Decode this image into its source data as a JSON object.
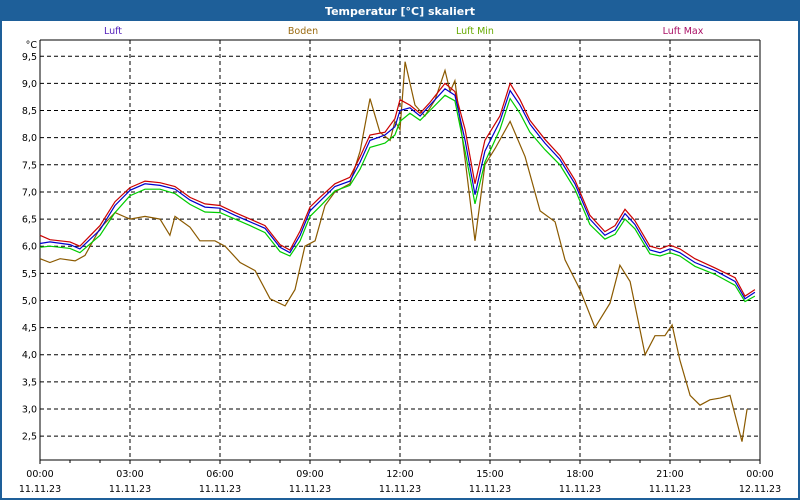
{
  "chart_data": {
    "type": "line",
    "title": "Temperatur [°C] skaliert",
    "ylabel": "°C",
    "xlabel": "",
    "ylim": [
      2.06,
      9.8
    ],
    "xlim_hours": [
      0,
      24
    ],
    "grid": true,
    "legend_placement": "top",
    "yticks": [
      2.5,
      3.0,
      3.5,
      4.0,
      4.5,
      5.0,
      5.5,
      6.0,
      6.5,
      7.0,
      7.5,
      8.0,
      8.5,
      9.0,
      9.5
    ],
    "ytick_labels": [
      "2,5",
      "3,0",
      "3,5",
      "4,0",
      "4,5",
      "5,0",
      "5,5",
      "6,0",
      "6,5",
      "7,0",
      "7,5",
      "8,0",
      "8,5",
      "9,0",
      "9,5"
    ],
    "xticks": [
      {
        "hour": 0,
        "time": "00:00",
        "date": "11.11.23"
      },
      {
        "hour": 3,
        "time": "03:00",
        "date": "11.11.23"
      },
      {
        "hour": 6,
        "time": "06:00",
        "date": "11.11.23"
      },
      {
        "hour": 9,
        "time": "09:00",
        "date": "11.11.23"
      },
      {
        "hour": 12,
        "time": "12:00",
        "date": "11.11.23"
      },
      {
        "hour": 15,
        "time": "15:00",
        "date": "11.11.23"
      },
      {
        "hour": 18,
        "time": "18:00",
        "date": "11.11.23"
      },
      {
        "hour": 21,
        "time": "21:00",
        "date": "11.11.23"
      },
      {
        "hour": 24,
        "time": "00:00",
        "date": "12.11.23"
      }
    ],
    "series": [
      {
        "name": "Luft",
        "color": "#0000cc",
        "label_color": "#5522bb",
        "x": [
          0,
          0.33,
          1,
          1.33,
          2,
          2.5,
          3,
          3.5,
          4,
          4.5,
          5,
          5.5,
          6,
          6.5,
          7,
          7.5,
          8,
          8.33,
          8.67,
          9,
          9.33,
          9.83,
          10.33,
          10.67,
          11,
          11.5,
          11.83,
          12,
          12.33,
          12.67,
          13,
          13.5,
          13.83,
          14.17,
          14.5,
          14.83,
          15.33,
          15.67,
          16,
          16.33,
          16.83,
          17.33,
          17.83,
          18.33,
          18.83,
          19.17,
          19.5,
          19.83,
          20.33,
          20.67,
          21,
          21.33,
          21.83,
          22.5,
          23.17,
          23.5,
          23.83
        ],
        "y": [
          6.05,
          6.08,
          6.03,
          5.95,
          6.3,
          6.75,
          7.03,
          7.15,
          7.12,
          7.05,
          6.85,
          6.72,
          6.7,
          6.57,
          6.45,
          6.33,
          5.98,
          5.88,
          6.2,
          6.65,
          6.83,
          7.1,
          7.2,
          7.55,
          7.95,
          8.05,
          8.2,
          8.5,
          8.55,
          8.4,
          8.6,
          8.9,
          8.78,
          7.95,
          6.95,
          7.75,
          8.3,
          8.87,
          8.6,
          8.25,
          7.9,
          7.6,
          7.15,
          6.5,
          6.2,
          6.3,
          6.6,
          6.4,
          5.93,
          5.88,
          5.95,
          5.88,
          5.7,
          5.55,
          5.35,
          5.03,
          5.15
        ]
      },
      {
        "name": "Boden",
        "color": "#8b5a00",
        "label_color": "#9a6a10",
        "x": [
          0,
          0.33,
          0.67,
          1.17,
          1.5,
          2,
          2.5,
          3,
          3.5,
          4,
          4.33,
          4.5,
          5,
          5.33,
          5.83,
          6.17,
          6.67,
          7.17,
          7.67,
          8.17,
          8.5,
          8.83,
          9.17,
          9.5,
          9.83,
          10.33,
          10.67,
          11,
          11.33,
          11.67,
          11.83,
          12,
          12.17,
          12.5,
          12.83,
          13.17,
          13.5,
          13.67,
          13.83,
          14.17,
          14.5,
          14.83,
          15.17,
          15.67,
          16.17,
          16.67,
          17.17,
          17.5,
          18,
          18.5,
          19,
          19.33,
          19.67,
          20.17,
          20.5,
          20.83,
          21.07,
          21.33,
          21.67,
          22,
          22.33,
          22.67,
          23,
          23.4,
          23.57
        ],
        "y": [
          5.77,
          5.7,
          5.77,
          5.73,
          5.83,
          6.33,
          6.62,
          6.5,
          6.55,
          6.5,
          6.2,
          6.55,
          6.35,
          6.1,
          6.1,
          6.0,
          5.7,
          5.55,
          5.03,
          4.9,
          5.2,
          6.0,
          6.1,
          6.75,
          7.0,
          7.15,
          7.75,
          8.72,
          8.1,
          7.95,
          8.3,
          8.15,
          9.4,
          8.6,
          8.4,
          8.7,
          9.24,
          8.85,
          9.05,
          7.6,
          6.1,
          7.5,
          7.8,
          8.3,
          7.65,
          6.65,
          6.45,
          5.75,
          5.2,
          4.5,
          4.95,
          5.65,
          5.35,
          4.0,
          4.35,
          4.35,
          4.55,
          3.9,
          3.25,
          3.07,
          3.17,
          3.2,
          3.25,
          2.4,
          3.0
        ]
      },
      {
        "name": "Luft Min",
        "color": "#00cc00",
        "label_color": "#66aa00",
        "x": [
          0,
          0.33,
          1,
          1.33,
          2,
          2.5,
          3,
          3.5,
          4,
          4.5,
          5,
          5.5,
          6,
          6.5,
          7,
          7.5,
          8,
          8.33,
          8.67,
          9,
          9.33,
          9.83,
          10.33,
          10.67,
          11,
          11.5,
          11.83,
          12,
          12.33,
          12.67,
          13,
          13.5,
          13.83,
          14.17,
          14.5,
          14.83,
          15.33,
          15.67,
          16,
          16.33,
          16.83,
          17.33,
          17.83,
          18.33,
          18.83,
          19.17,
          19.5,
          19.83,
          20.33,
          20.67,
          21,
          21.33,
          21.83,
          22.5,
          23.17,
          23.5,
          23.83
        ],
        "y": [
          5.98,
          6.0,
          5.96,
          5.88,
          6.2,
          6.62,
          6.93,
          7.05,
          7.05,
          6.97,
          6.77,
          6.63,
          6.62,
          6.5,
          6.38,
          6.25,
          5.9,
          5.82,
          6.1,
          6.55,
          6.73,
          7.02,
          7.12,
          7.42,
          7.82,
          7.9,
          8.05,
          8.3,
          8.45,
          8.32,
          8.5,
          8.78,
          8.68,
          7.75,
          6.78,
          7.55,
          8.15,
          8.72,
          8.45,
          8.1,
          7.78,
          7.5,
          7.05,
          6.4,
          6.13,
          6.22,
          6.5,
          6.32,
          5.86,
          5.82,
          5.88,
          5.82,
          5.63,
          5.48,
          5.28,
          4.98,
          5.08
        ]
      },
      {
        "name": "Luft Max",
        "color": "#cc0000",
        "label_color": "#aa1166",
        "x": [
          0,
          0.33,
          1,
          1.33,
          2,
          2.5,
          3,
          3.5,
          4,
          4.5,
          5,
          5.5,
          6,
          6.5,
          7,
          7.5,
          8,
          8.33,
          8.67,
          9,
          9.33,
          9.83,
          10.33,
          10.67,
          11,
          11.5,
          11.83,
          12,
          12.33,
          12.67,
          13,
          13.5,
          13.83,
          14.17,
          14.5,
          14.83,
          15.33,
          15.67,
          16,
          16.33,
          16.83,
          17.33,
          17.83,
          18.33,
          18.83,
          19.17,
          19.5,
          19.83,
          20.33,
          20.67,
          21,
          21.33,
          21.83,
          22.5,
          23.17,
          23.5,
          23.83
        ],
        "y": [
          6.2,
          6.12,
          6.08,
          6.0,
          6.38,
          6.82,
          7.08,
          7.2,
          7.17,
          7.1,
          6.9,
          6.78,
          6.75,
          6.62,
          6.5,
          6.38,
          6.03,
          5.93,
          6.28,
          6.72,
          6.9,
          7.15,
          7.27,
          7.65,
          8.05,
          8.1,
          8.35,
          8.7,
          8.6,
          8.45,
          8.65,
          9.0,
          8.85,
          8.15,
          7.15,
          7.95,
          8.4,
          9.0,
          8.7,
          8.32,
          7.97,
          7.67,
          7.22,
          6.57,
          6.27,
          6.38,
          6.68,
          6.47,
          6.0,
          5.95,
          6.02,
          5.95,
          5.77,
          5.6,
          5.42,
          5.08,
          5.2
        ]
      }
    ]
  }
}
